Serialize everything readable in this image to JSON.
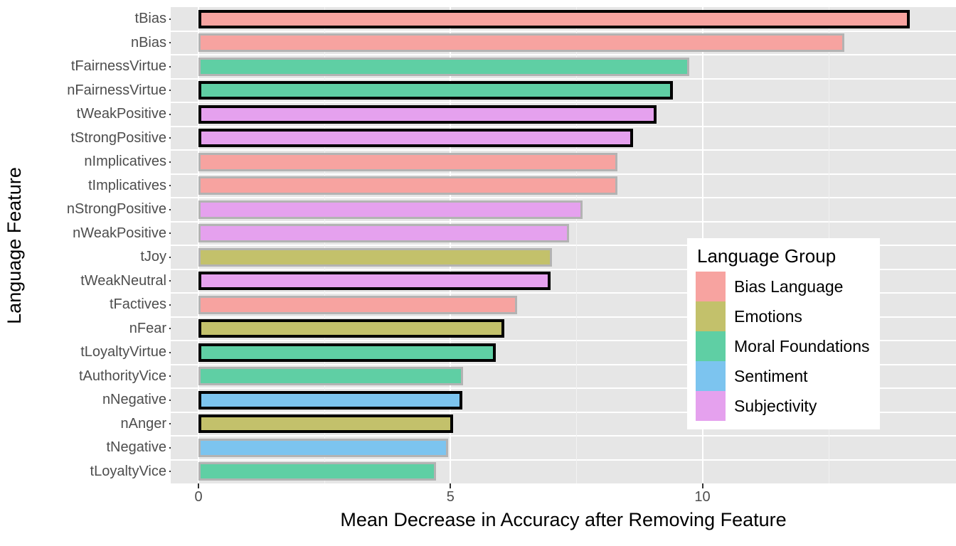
{
  "chart_data": {
    "type": "bar",
    "orientation": "horizontal",
    "title": "",
    "xlabel": "Mean Decrease in Accuracy after Removing Feature",
    "ylabel": "Language Feature",
    "xlim": [
      0,
      14.9
    ],
    "x_ticks": [
      0,
      5,
      10
    ],
    "x_tick_labels": [
      "0",
      "5",
      "10"
    ],
    "grid": "major and minor vertical, major horizontal, white on grey panel",
    "legend_position": "inside bottom-right",
    "legend_title": "Language Group",
    "categories": [
      "tBias",
      "nBias",
      "tFairnessVirtue",
      "nFairnessVirtue",
      "tWeakPositive",
      "tStrongPositive",
      "nImplicatives",
      "tImplicatives",
      "nStrongPositive",
      "nWeakPositive",
      "tJoy",
      "tWeakNeutral",
      "tFactives",
      "nFear",
      "tLoyaltyVirtue",
      "tAuthorityVice",
      "nNegative",
      "nAnger",
      "tNegative",
      "tLoyaltyVice"
    ],
    "values": [
      14.12,
      12.82,
      9.74,
      9.42,
      9.09,
      8.62,
      8.32,
      8.32,
      7.62,
      7.36,
      7.01,
      6.99,
      6.33,
      6.07,
      5.9,
      5.25,
      5.23,
      5.05,
      4.96,
      4.71
    ],
    "groups": [
      "Bias Language",
      "Bias Language",
      "Moral Foundations",
      "Moral Foundations",
      "Subjectivity",
      "Subjectivity",
      "Bias Language",
      "Bias Language",
      "Subjectivity",
      "Subjectivity",
      "Emotions",
      "Subjectivity",
      "Bias Language",
      "Emotions",
      "Moral Foundations",
      "Moral Foundations",
      "Sentiment",
      "Emotions",
      "Sentiment",
      "Moral Foundations"
    ],
    "highlighted": [
      true,
      false,
      false,
      true,
      true,
      true,
      false,
      false,
      false,
      false,
      false,
      true,
      false,
      true,
      true,
      false,
      true,
      true,
      false,
      false
    ],
    "series": [
      {
        "name": "Bias Language",
        "color": "#F7A3A0",
        "categories": [
          "tBias",
          "nBias",
          "nImplicatives",
          "tImplicatives",
          "tFactives"
        ],
        "values": [
          14.12,
          12.82,
          8.32,
          8.32,
          6.33
        ]
      },
      {
        "name": "Emotions",
        "color": "#C3C16B",
        "categories": [
          "tJoy",
          "nFear",
          "nAnger"
        ],
        "values": [
          7.01,
          6.07,
          5.05
        ]
      },
      {
        "name": "Moral Foundations",
        "color": "#5FCFA4",
        "categories": [
          "tFairnessVirtue",
          "nFairnessVirtue",
          "tLoyaltyVirtue",
          "tAuthorityVice",
          "tLoyaltyVice"
        ],
        "values": [
          9.74,
          9.42,
          5.9,
          5.25,
          4.71
        ]
      },
      {
        "name": "Sentiment",
        "color": "#7CC4EF",
        "categories": [
          "nNegative",
          "tNegative"
        ],
        "values": [
          5.23,
          4.96
        ]
      },
      {
        "name": "Subjectivity",
        "color": "#E5A1EE",
        "categories": [
          "tWeakPositive",
          "tStrongPositive",
          "nStrongPositive",
          "nWeakPositive",
          "tWeakNeutral"
        ],
        "values": [
          9.09,
          8.62,
          7.62,
          7.36,
          6.99
        ]
      }
    ]
  },
  "axes": {
    "y_title": "Language Feature",
    "x_title": "Mean Decrease in Accuracy after Removing Feature"
  },
  "legend": {
    "title": "Language Group",
    "items": [
      {
        "label": "Bias Language",
        "color": "#F7A3A0"
      },
      {
        "label": "Emotions",
        "color": "#C3C16B"
      },
      {
        "label": "Moral Foundations",
        "color": "#5FCFA4"
      },
      {
        "label": "Sentiment",
        "color": "#7CC4EF"
      },
      {
        "label": "Subjectivity",
        "color": "#E5A1EE"
      }
    ]
  },
  "panel": {
    "background": "#E6E6E6",
    "gridline_color": "#FFFFFF",
    "bar_outline_normal": "#B3B3B3",
    "bar_outline_highlight": "#000000"
  }
}
